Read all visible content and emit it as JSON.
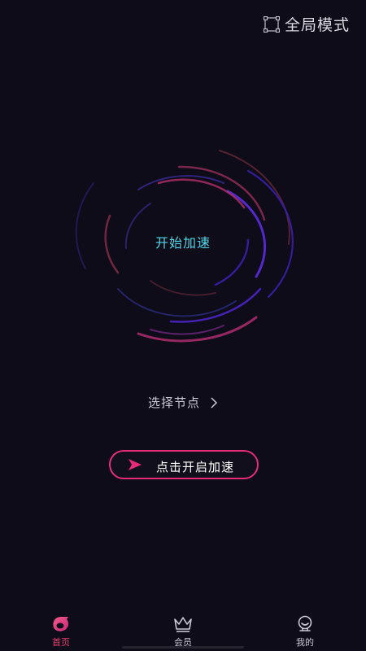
{
  "header": {
    "mode_label": "全局模式",
    "mode_icon": "frame-icon"
  },
  "main": {
    "center_label": "开始加速",
    "select_node_label": "选择节点",
    "boost_button_label": "点击开启加速"
  },
  "bottom_nav": {
    "items": [
      {
        "label": "首页",
        "icon": "home-icon",
        "active": true
      },
      {
        "label": "会员",
        "icon": "crown-icon",
        "active": false
      },
      {
        "label": "我的",
        "icon": "profile-icon",
        "active": false
      }
    ]
  },
  "colors": {
    "background": "#0d0c18",
    "accent_pink": "#e62b7a",
    "accent_cyan": "#4fd6e6",
    "accent_purple": "#5a2ad6"
  }
}
